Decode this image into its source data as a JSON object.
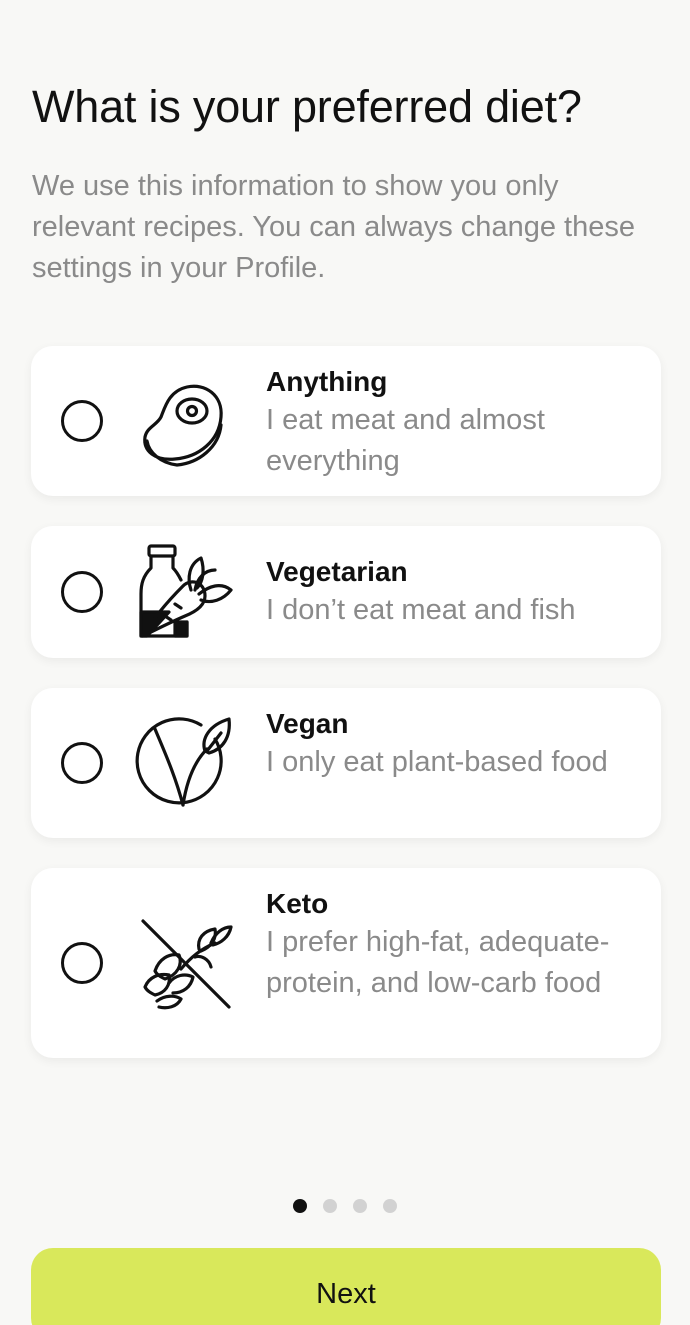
{
  "header": {
    "title": "What is your preferred diet?",
    "subtitle": "We use this information to show you only relevant recipes. You can always change these settings in your Profile."
  },
  "options": [
    {
      "title": "Anything",
      "description": "I eat meat and almost everything",
      "icon": "steak-icon",
      "selected": false
    },
    {
      "title": "Vegetarian",
      "description": "I don’t eat meat and fish",
      "icon": "milk-carrot-icon",
      "selected": false
    },
    {
      "title": "Vegan",
      "description": "I only eat plant-based food",
      "icon": "vegan-leaf-icon",
      "selected": false
    },
    {
      "title": "Keto",
      "description": "I prefer high-fat, adequate-protein, and low-carb food",
      "icon": "no-carbs-icon",
      "selected": false
    }
  ],
  "pagination": {
    "total": 4,
    "current": 1
  },
  "footer": {
    "next_label": "Next"
  },
  "colors": {
    "accent": "#d9e85b",
    "background": "#f8f8f6",
    "card": "#ffffff",
    "muted_text": "#8a8a8a"
  }
}
